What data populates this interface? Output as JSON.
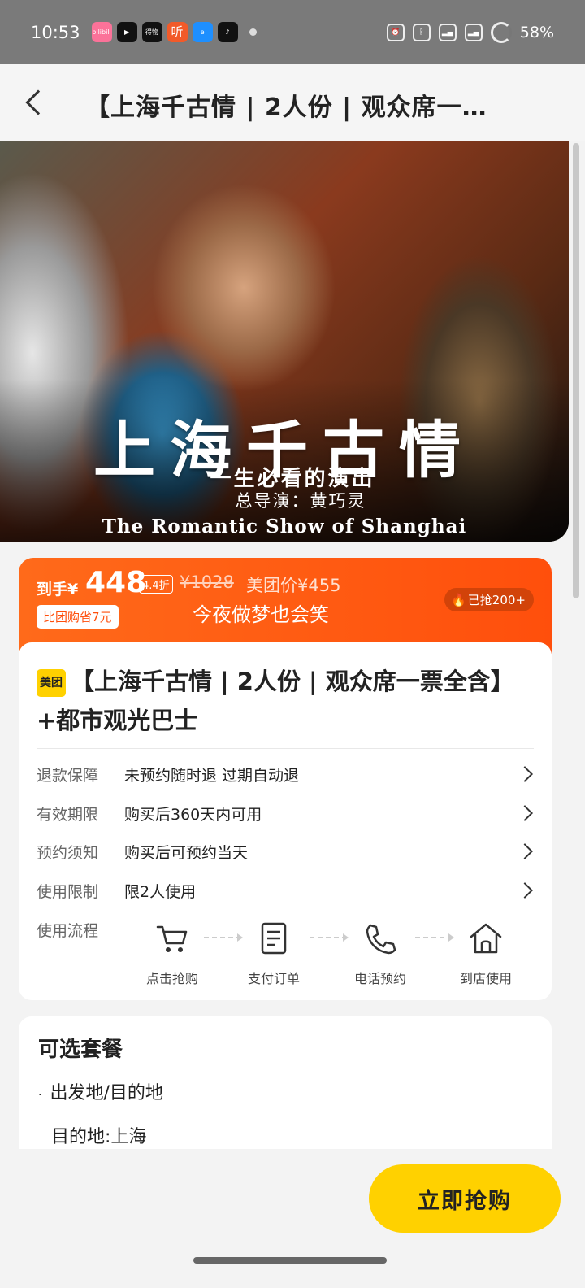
{
  "status_bar": {
    "time": "10:53",
    "battery": "58%",
    "app_icons": [
      {
        "name": "bilibili-app-icon",
        "label": "bilibili",
        "color": "#fb7299"
      },
      {
        "name": "kuaishou-app-icon",
        "label": "",
        "color": "#111111"
      },
      {
        "name": "dewu-app-icon",
        "label": "得物",
        "color": "#111111"
      },
      {
        "name": "ting-app-icon",
        "label": "听",
        "color": "#f25a29"
      },
      {
        "name": "eleme-app-icon",
        "label": "",
        "color": "#1e8fff"
      },
      {
        "name": "tiktok-app-icon",
        "label": "",
        "color": "#111111"
      }
    ]
  },
  "header": {
    "title": "【上海千古情 | 2人份 | 观众席一票全含】+都市观光巴士"
  },
  "hero": {
    "title": "上海千古情",
    "subtitle": "一生必看的演出",
    "director": "总导演：黄巧灵",
    "english_title": "The Romantic Show of Shanghai"
  },
  "price": {
    "label": "到手¥",
    "current": "448",
    "discount": "4.4折",
    "original": "¥1028",
    "meituan_price": "美团价¥455",
    "saving": "比团购省7元",
    "slogan": "今夜做梦也会笑",
    "sold": "已抢200+"
  },
  "product": {
    "badge": "美团",
    "title": "【上海千古情 | 2人份 | 观众席一票全含】+都市观光巴士"
  },
  "info_rows": [
    {
      "label": "退款保障",
      "value": "未预约随时退 过期自动退"
    },
    {
      "label": "有效期限",
      "value": "购买后360天内可用"
    },
    {
      "label": "预约须知",
      "value": "购买后可预约当天"
    },
    {
      "label": "使用限制",
      "value": "限2人使用"
    }
  ],
  "process": {
    "label": "使用流程",
    "steps": [
      {
        "label": "点击抢购",
        "icon": "cart-icon"
      },
      {
        "label": "支付订单",
        "icon": "order-document-icon"
      },
      {
        "label": "电话预约",
        "icon": "phone-icon"
      },
      {
        "label": "到店使用",
        "icon": "house-icon"
      }
    ]
  },
  "package": {
    "title": "可选套餐",
    "origin_label": "出发地/目的地",
    "destination": "目的地:上海"
  },
  "buy_button": "立即抢购"
}
